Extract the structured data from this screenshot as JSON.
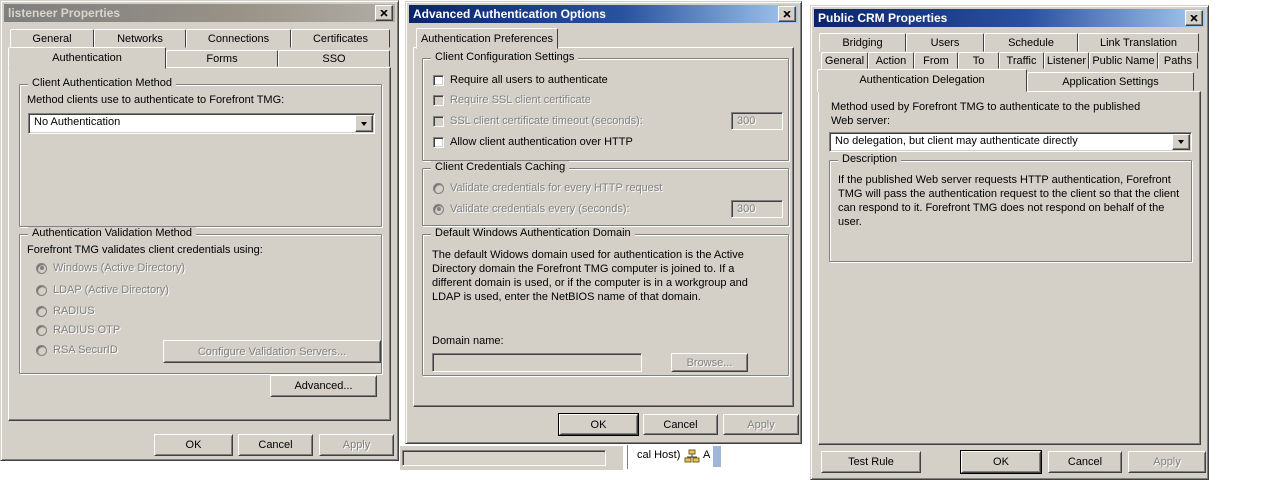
{
  "listener_dialog": {
    "title": "listeneer Properties",
    "tabs_back": [
      "General",
      "Networks",
      "Connections",
      "Certificates"
    ],
    "tabs_front": [
      "Authentication",
      "Forms",
      "SSO"
    ],
    "client_auth_group": {
      "title": "Client Authentication Method",
      "label": "Method clients use to authenticate to Forefront TMG:",
      "dropdown_value": "No Authentication"
    },
    "validation_group": {
      "title": "Authentication Validation Method",
      "label": "Forefront TMG validates client credentials using:",
      "radios": [
        "Windows (Active Directory)",
        "LDAP (Active Directory)",
        "RADIUS",
        "RADIUS OTP",
        "RSA SecurID"
      ],
      "selected_radio": "Windows (Active Directory)",
      "configure_button": "Configure Validation Servers..."
    },
    "advanced_button": "Advanced...",
    "buttons": {
      "ok": "OK",
      "cancel": "Cancel",
      "apply": "Apply"
    }
  },
  "advanced_dialog": {
    "title": "Advanced Authentication Options",
    "tab": "Authentication Preferences",
    "client_config_group": {
      "title": "Client Configuration Settings",
      "cb_require_all": "Require all users to authenticate",
      "cb_require_ssl": "Require SSL client certificate",
      "cb_ssl_timeout": "SSL client certificate timeout (seconds):",
      "ssl_timeout_value": "300",
      "cb_allow_http": "Allow client authentication over HTTP"
    },
    "caching_group": {
      "title": "Client Credentials Caching",
      "radio_every_request": "Validate credentials for every HTTP request",
      "radio_every_seconds": "Validate credentials every (seconds):",
      "seconds_value": "300"
    },
    "domain_group": {
      "title": "Default Windows Authentication Domain",
      "text": "The default Widows domain used for authentication is the Active Directory domain the Forefront TMG computer is joined to. If a different domain is used, or if the computer is in a workgroup and LDAP is used, enter the NetBIOS name of that domain.",
      "domain_label": "Domain name:",
      "domain_value": "",
      "browse_button": "Browse..."
    },
    "buttons": {
      "ok": "OK",
      "cancel": "Cancel",
      "apply": "Apply"
    }
  },
  "crm_dialog": {
    "title": "Public CRM Properties",
    "tabs_row1": [
      "Bridging",
      "Users",
      "Schedule",
      "Link Translation"
    ],
    "tabs_row2": [
      "General",
      "Action",
      "From",
      "To",
      "Traffic",
      "Listener",
      "Public Name",
      "Paths"
    ],
    "tabs_row3": [
      "Authentication Delegation",
      "Application Settings"
    ],
    "method_label": "Method used by Forefront TMG to authenticate to the published Web server:",
    "dropdown_value": "No delegation, but client may authenticate directly",
    "description_group": {
      "title": "Description",
      "text": "If the published Web server requests HTTP authentication, Forefront TMG will pass the authentication request to the client so that the client can respond to it. Forefront TMG does not respond on behalf of the user."
    },
    "buttons": {
      "test_rule": "Test Rule",
      "ok": "OK",
      "cancel": "Cancel",
      "apply": "Apply"
    }
  },
  "background_window": {
    "status_text": "cal Host)",
    "item_letter": "A"
  },
  "colors": {
    "dialog_face": "#d4d0c8",
    "active_title_start": "#0a246a",
    "active_title_end": "#a6caf0",
    "inactive_title_start": "#7f7f7f",
    "inactive_title_end": "#b1ada5",
    "disabled_text": "#808080",
    "selection_bar": "#9fb6d9"
  }
}
